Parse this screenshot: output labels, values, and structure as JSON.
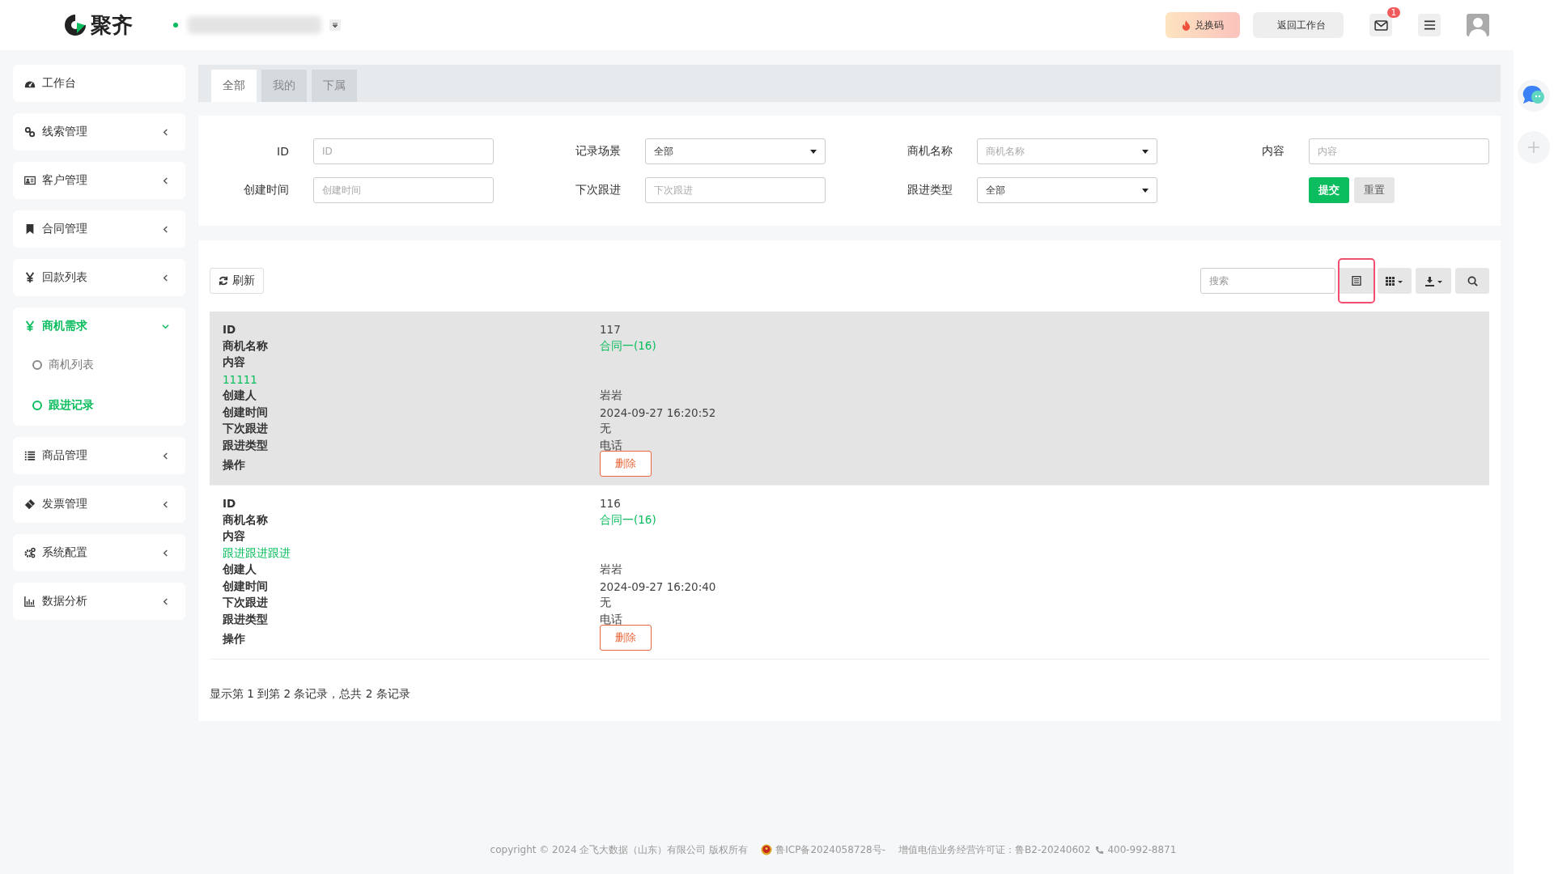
{
  "header": {
    "logo_text": "聚齐",
    "workspace": {
      "online": true
    },
    "redeem_button": "兑换码",
    "back_button": "返回工作台",
    "mail_badge": "1"
  },
  "sidebar": {
    "items": [
      {
        "label": "工作台",
        "expandable": false,
        "expanded": false,
        "selected": false
      },
      {
        "label": "线索管理",
        "expandable": true,
        "expanded": false,
        "selected": false
      },
      {
        "label": "客户管理",
        "expandable": true,
        "expanded": false,
        "selected": false
      },
      {
        "label": "合同管理",
        "expandable": true,
        "expanded": false,
        "selected": false
      },
      {
        "label": "回款列表",
        "expandable": true,
        "expanded": false,
        "selected": false
      },
      {
        "label": "商机需求",
        "expandable": true,
        "expanded": true,
        "selected": true,
        "children": [
          {
            "label": "商机列表",
            "selected": false
          },
          {
            "label": "跟进记录",
            "selected": true
          }
        ]
      },
      {
        "label": "商品管理",
        "expandable": true,
        "expanded": false,
        "selected": false
      },
      {
        "label": "发票管理",
        "expandable": true,
        "expanded": false,
        "selected": false
      },
      {
        "label": "系统配置",
        "expandable": true,
        "expanded": false,
        "selected": false
      },
      {
        "label": "数据分析",
        "expandable": true,
        "expanded": false,
        "selected": false
      }
    ]
  },
  "tabs": [
    {
      "label": "全部",
      "selected": true
    },
    {
      "label": "我的",
      "selected": false
    },
    {
      "label": "下属",
      "selected": false
    }
  ],
  "filters": {
    "fields": [
      {
        "kind": "input",
        "label": "ID",
        "placeholder": "ID"
      },
      {
        "kind": "select",
        "label": "记录场景",
        "value": "全部"
      },
      {
        "kind": "select",
        "label": "商机名称",
        "placeholder": "商机名称"
      },
      {
        "kind": "input",
        "label": "内容",
        "placeholder": "内容"
      },
      {
        "kind": "input",
        "label": "创建时间",
        "placeholder": "创建时间"
      },
      {
        "kind": "input",
        "label": "下次跟进",
        "placeholder": "下次跟进"
      },
      {
        "kind": "select",
        "label": "跟进类型",
        "value": "全部"
      }
    ],
    "submit": "提交",
    "reset": "重置"
  },
  "toolbar": {
    "refresh": "刷新",
    "search_placeholder": "搜索",
    "buttons": [
      {
        "kind": "card-view",
        "annotated": true
      },
      {
        "kind": "columns",
        "annotated": false
      },
      {
        "kind": "export",
        "annotated": false
      },
      {
        "kind": "search",
        "annotated": false
      }
    ]
  },
  "records": [
    {
      "highlighted": true,
      "fields": [
        {
          "kind": "text",
          "label": "ID",
          "value": "117"
        },
        {
          "kind": "link",
          "label": "商机名称",
          "value": "合同一(16)"
        },
        {
          "kind": "block",
          "label": "内容",
          "value": "11111"
        },
        {
          "kind": "text",
          "label": "创建人",
          "value": "岩岩"
        },
        {
          "kind": "text",
          "label": "创建时间",
          "value": "2024-09-27 16:20:52"
        },
        {
          "kind": "text",
          "label": "下次跟进",
          "value": "无"
        },
        {
          "kind": "text",
          "label": "跟进类型",
          "value": "电话"
        },
        {
          "kind": "button",
          "label": "操作",
          "value": "删除"
        }
      ]
    },
    {
      "highlighted": false,
      "fields": [
        {
          "kind": "text",
          "label": "ID",
          "value": "116"
        },
        {
          "kind": "link",
          "label": "商机名称",
          "value": "合同一(16)"
        },
        {
          "kind": "block",
          "label": "内容",
          "value": "跟进跟进跟进"
        },
        {
          "kind": "text",
          "label": "创建人",
          "value": "岩岩"
        },
        {
          "kind": "text",
          "label": "创建时间",
          "value": "2024-09-27 16:20:40"
        },
        {
          "kind": "text",
          "label": "下次跟进",
          "value": "无"
        },
        {
          "kind": "text",
          "label": "跟进类型",
          "value": "电话"
        },
        {
          "kind": "button",
          "label": "操作",
          "value": "删除"
        }
      ]
    }
  ],
  "pagination": "显示第 1 到第 2 条记录，总共 2 条记录",
  "footer": {
    "copyright": "copyright © 2024 企飞大数据（山东）有限公司 版权所有",
    "icp": "鲁ICP备2024058728号-",
    "license": "增值电信业务经营许可证：鲁B2-20240602",
    "phone": "400-992-8871"
  }
}
